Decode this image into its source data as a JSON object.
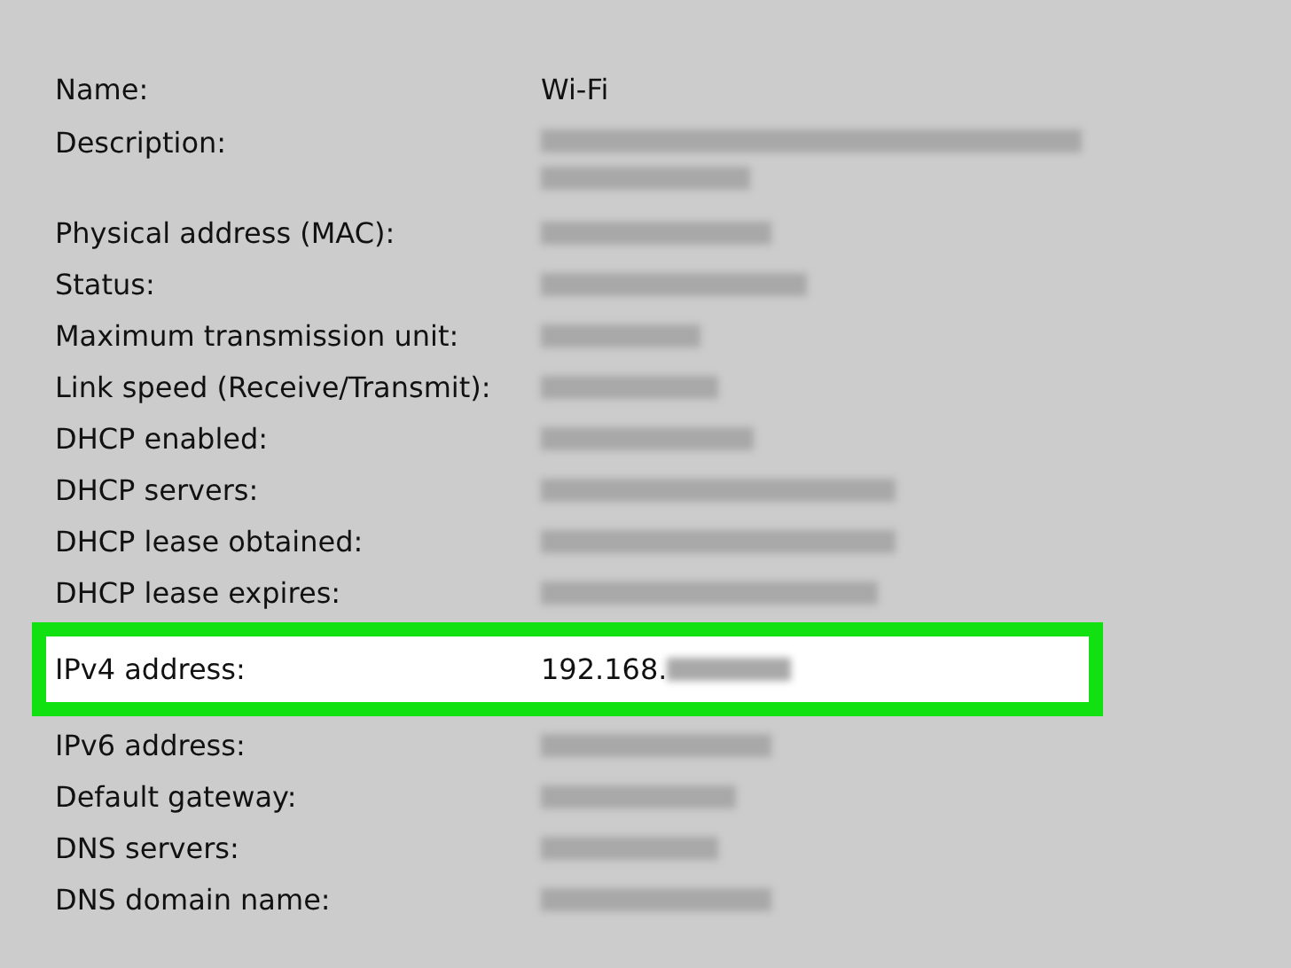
{
  "rows": [
    {
      "label": "Name:",
      "kind": "plain",
      "value": "Wi-Fi",
      "highlighted": false
    },
    {
      "label": "Description:",
      "kind": "redacted-long",
      "highlighted": false
    },
    {
      "label": "Physical address (MAC):",
      "kind": "redacted",
      "highlighted": false
    },
    {
      "label": "Status:",
      "kind": "redacted",
      "highlighted": false
    },
    {
      "label": "Maximum transmission unit:",
      "kind": "redacted",
      "highlighted": false
    },
    {
      "label": "Link speed (Receive/Transmit):",
      "kind": "redacted",
      "highlighted": false
    },
    {
      "label": "DHCP enabled:",
      "kind": "redacted",
      "highlighted": false
    },
    {
      "label": "DHCP servers:",
      "kind": "redacted",
      "highlighted": false
    },
    {
      "label": "DHCP lease obtained:",
      "kind": "redacted",
      "highlighted": false
    },
    {
      "label": "DHCP lease expires:",
      "kind": "redacted",
      "highlighted": false
    },
    {
      "label": "IPv4 address:",
      "kind": "partly-redacted",
      "value": "192.168.",
      "highlighted": true
    },
    {
      "label": "IPv6 address:",
      "kind": "redacted",
      "highlighted": false
    },
    {
      "label": "Default gateway:",
      "kind": "redacted",
      "highlighted": false
    },
    {
      "label": "DNS servers:",
      "kind": "redacted",
      "highlighted": false
    },
    {
      "label": "DNS domain name:",
      "kind": "redacted",
      "highlighted": false
    }
  ]
}
